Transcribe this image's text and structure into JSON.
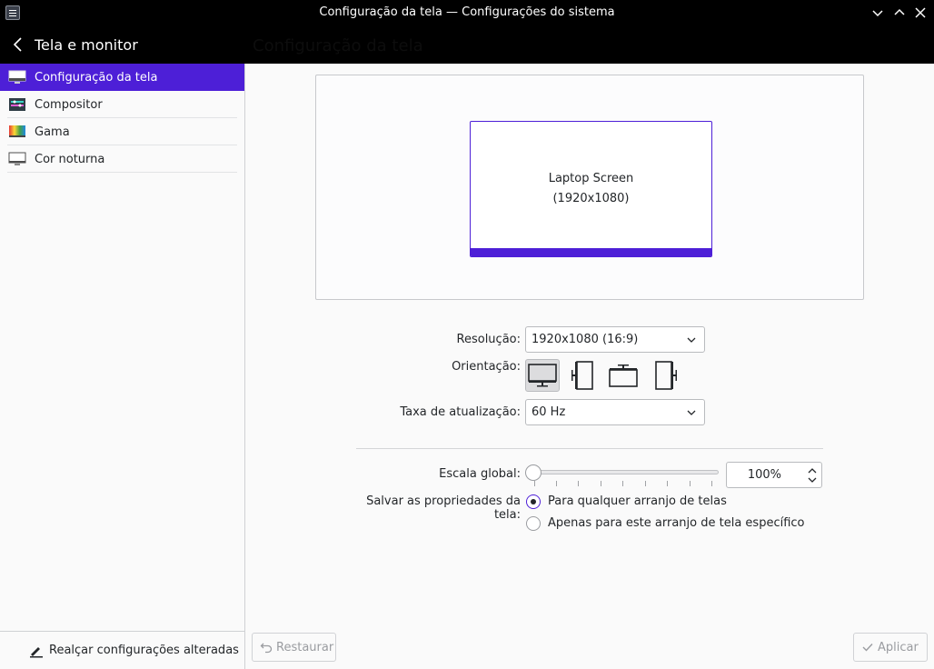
{
  "window": {
    "title": "Configuração da tela — Configurações do sistema"
  },
  "sidebar": {
    "heading": "Tela e monitor",
    "items": [
      {
        "label": "Configuração da tela",
        "icon": "display-icon",
        "active": true
      },
      {
        "label": "Compositor",
        "icon": "compositor-icon",
        "active": false
      },
      {
        "label": "Gama",
        "icon": "gamma-icon",
        "active": false
      },
      {
        "label": "Cor noturna",
        "icon": "night-color-icon",
        "active": false
      }
    ],
    "footer_label": "Realçar configurações alteradas"
  },
  "main": {
    "title": "Configuração da tela",
    "screen": {
      "name": "Laptop Screen",
      "resolution": "(1920x1080)"
    },
    "resolution": {
      "label": "Resolução:",
      "value": "1920x1080 (16:9)"
    },
    "orientation": {
      "label": "Orientação:",
      "options": [
        "landscape",
        "portrait-left",
        "landscape-flipped",
        "portrait-right"
      ],
      "selected": "landscape"
    },
    "refresh": {
      "label": "Taxa de atualização:",
      "value": "60 Hz"
    },
    "scale": {
      "label": "Escala global:",
      "value": "100%",
      "slider_fraction": 0.0
    },
    "save": {
      "label": "Salvar as propriedades da tela:",
      "options": [
        {
          "label": "Para qualquer arranjo de telas",
          "checked": true
        },
        {
          "label": "Apenas para este arranjo de tela específico",
          "checked": false
        }
      ]
    },
    "buttons": {
      "reset": "Restaurar",
      "apply": "Aplicar"
    }
  },
  "colors": {
    "accent": "#4d1fd7",
    "titlebar": "#000000"
  }
}
